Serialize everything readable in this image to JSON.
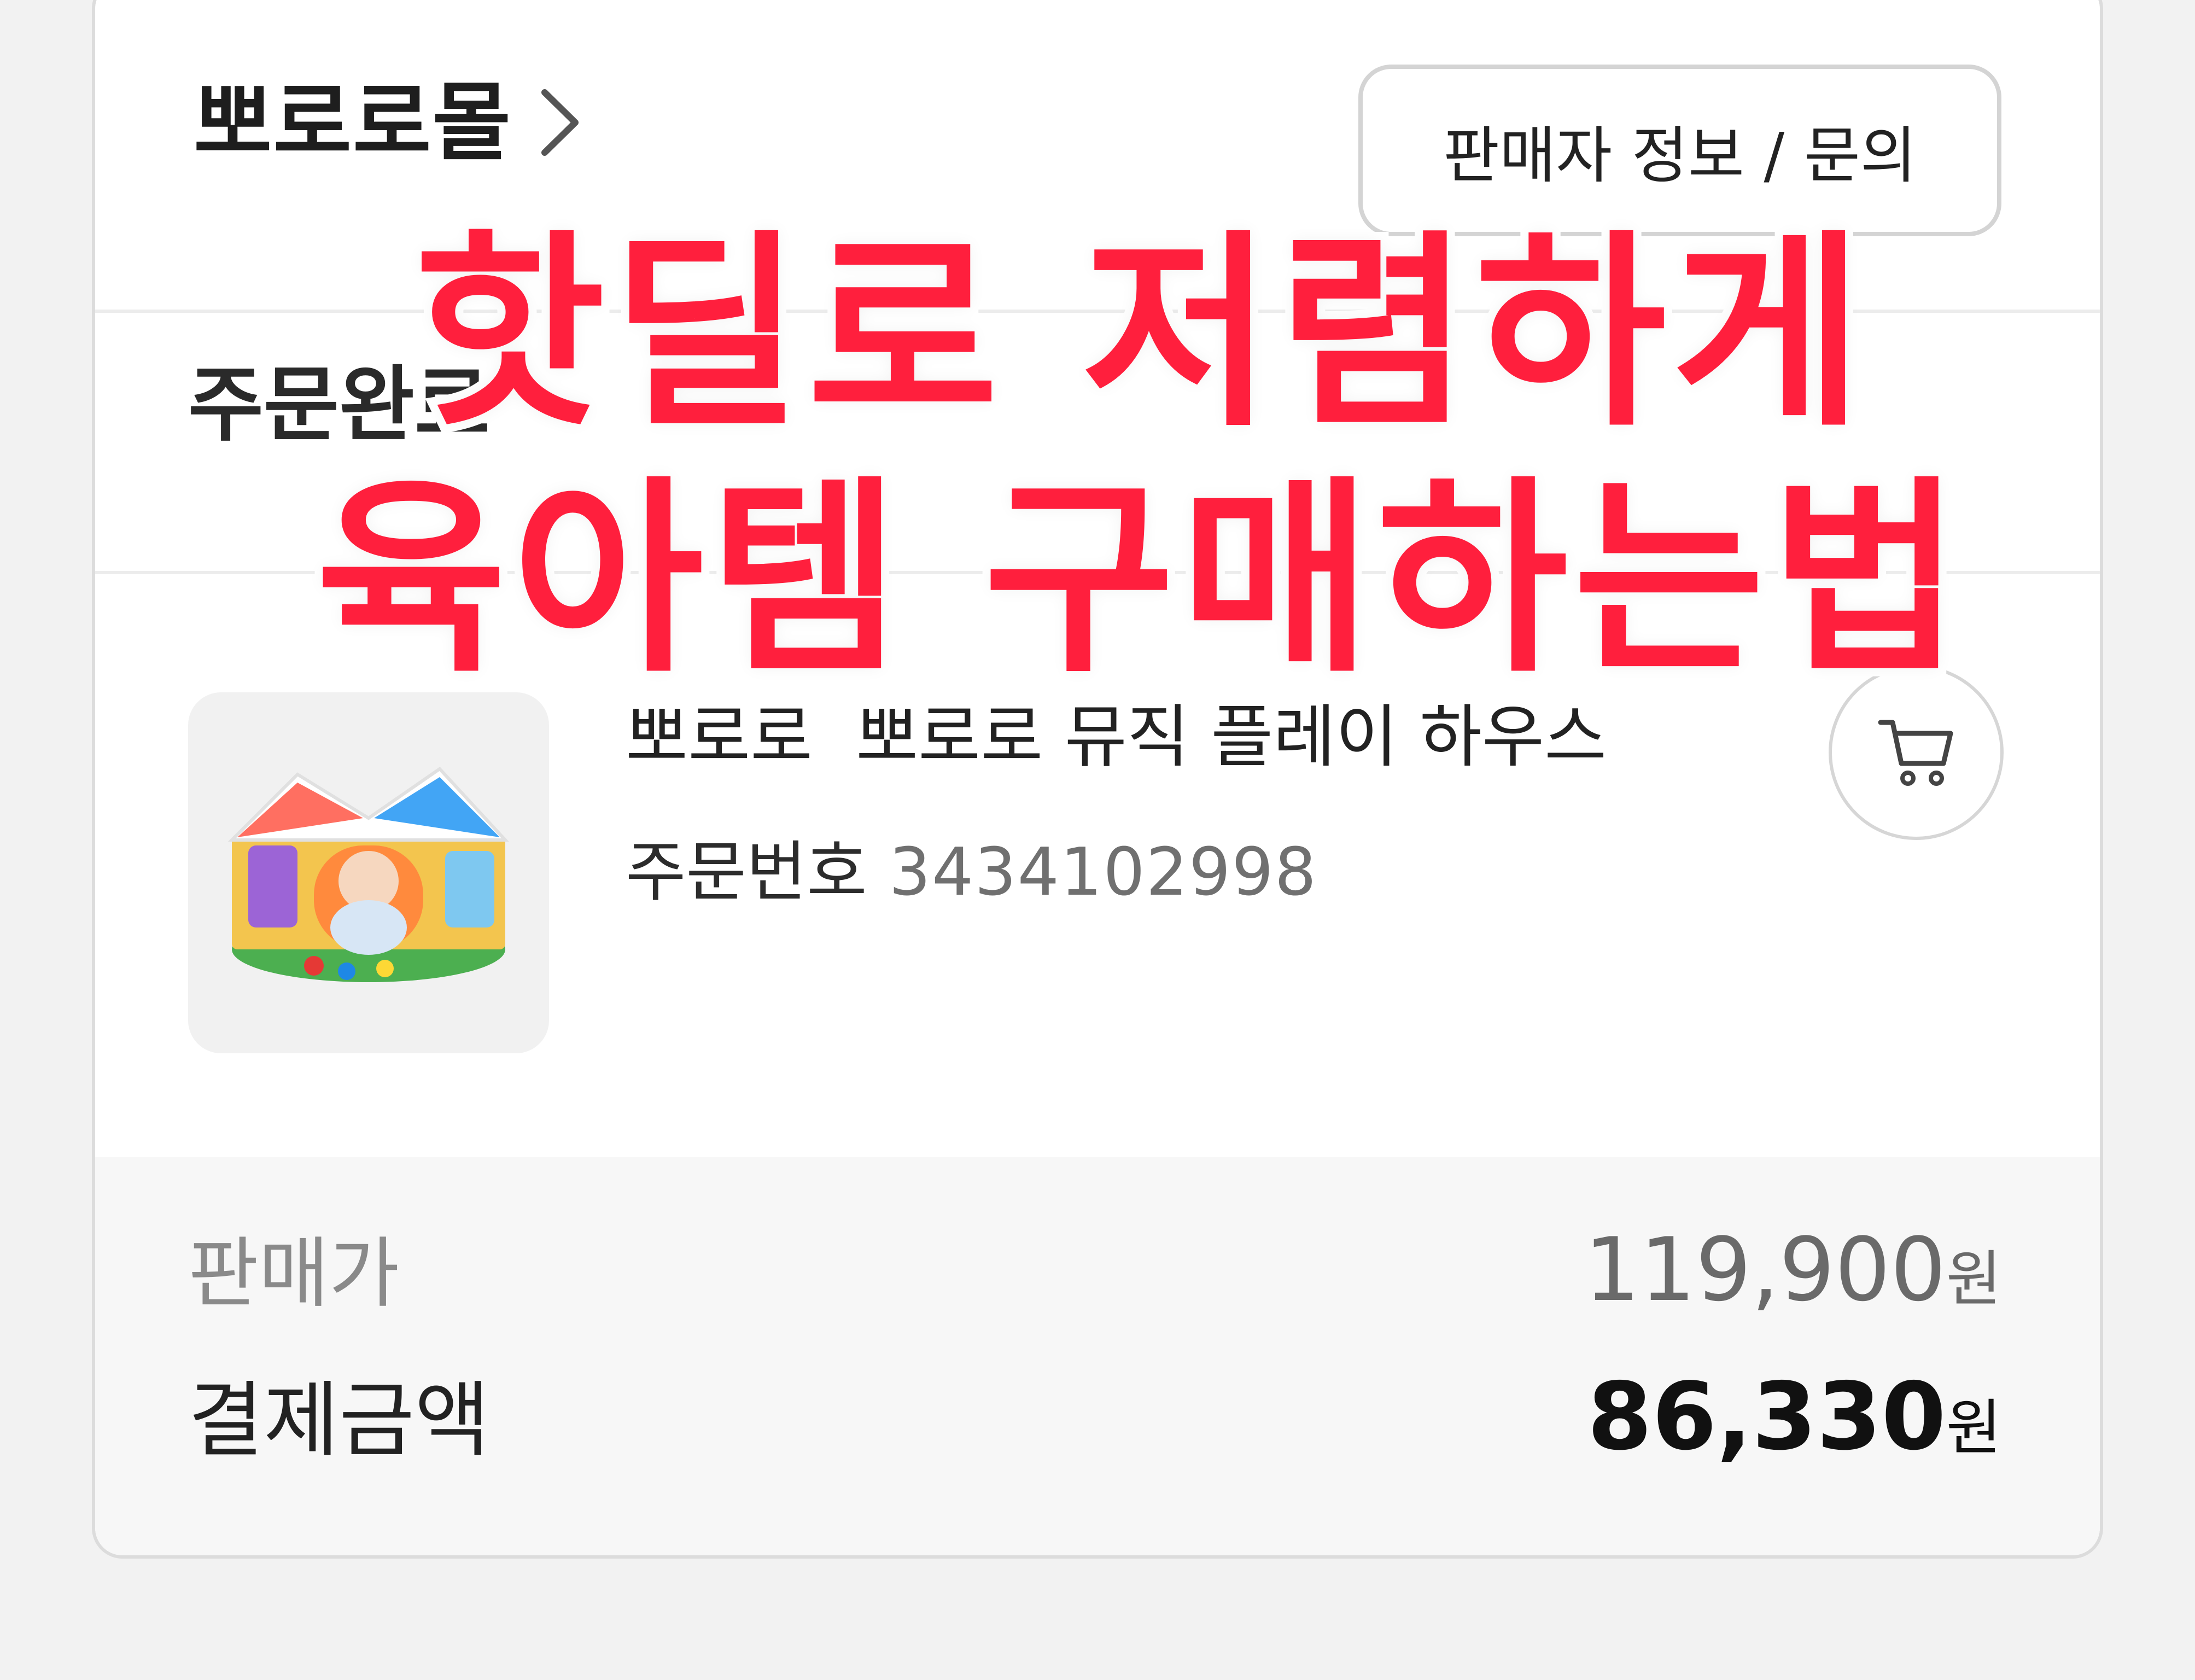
{
  "store": {
    "name": "뽀로로몰",
    "seller_button": "판매자 정보 / 문의"
  },
  "order": {
    "status": "주문완료",
    "product_name": "뽀로로  뽀로로 뮤직 플레이 하우스",
    "order_number_label": "주문번호",
    "order_number": "3434102998"
  },
  "prices": {
    "sale_label": "판매가",
    "sale_value": "119,900",
    "sale_unit": "원",
    "payment_label": "결제금액",
    "payment_value": "86,330",
    "payment_unit": "원"
  },
  "overlay": {
    "line1": "핫딜로 저렴하게",
    "line2": "육아템 구매하는법",
    "color": "#ff1f3d"
  },
  "icons": {
    "shop_chevron": "chevron-right-icon",
    "cart": "cart-icon"
  }
}
